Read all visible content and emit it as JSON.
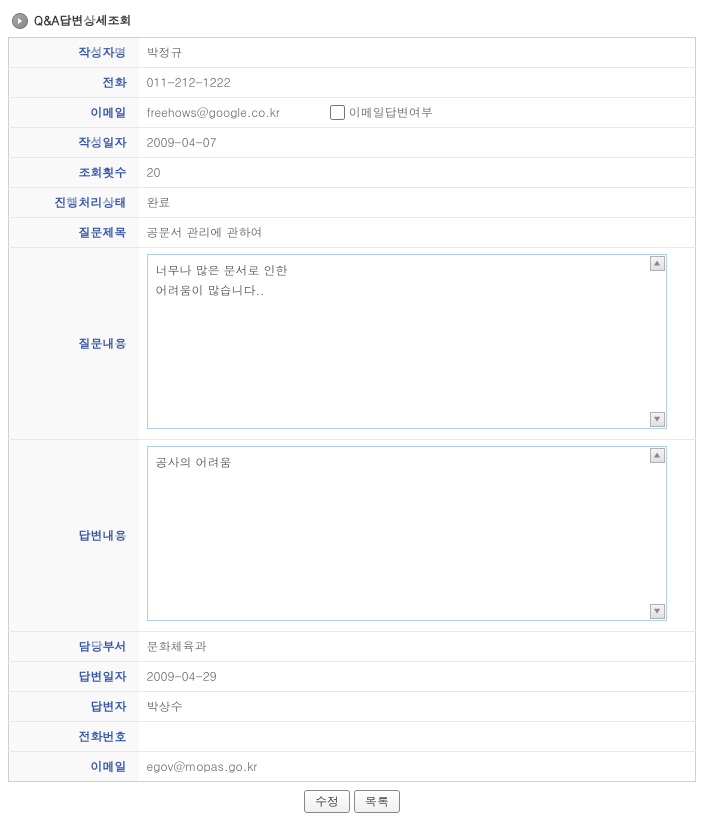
{
  "page": {
    "title": "Q&A답변상세조회"
  },
  "labels": {
    "author_name": "작성자명",
    "phone": "전화",
    "email": "이메일",
    "email_reply": "이메일답변여부",
    "created_date": "작성일자",
    "view_count": "조회횟수",
    "process_status": "진행처리상태",
    "question_title": "질문제목",
    "question_content": "질문내용",
    "answer_content": "답변내용",
    "department": "담당부서",
    "answer_date": "답변일자",
    "answerer": "답변자",
    "answerer_phone": "전화번호",
    "answerer_email": "이메일"
  },
  "values": {
    "author_name": "박정규",
    "phone": "011-212-1222",
    "email": "freehows@google.co.kr",
    "created_date": "2009-04-07",
    "view_count": "20",
    "process_status": "완료",
    "question_title": "공문서 관리에 관하여",
    "question_content": "너무나 많은 문서로 인한\n어려움이 많습니다..",
    "answer_content": "공사의 어려움",
    "department": "문화체육과",
    "answer_date": "2009-04-29",
    "answerer": "박상수",
    "answerer_phone": "",
    "answerer_email": "egov@mopas.go.kr"
  },
  "buttons": {
    "edit": "수정",
    "list": "목록"
  }
}
